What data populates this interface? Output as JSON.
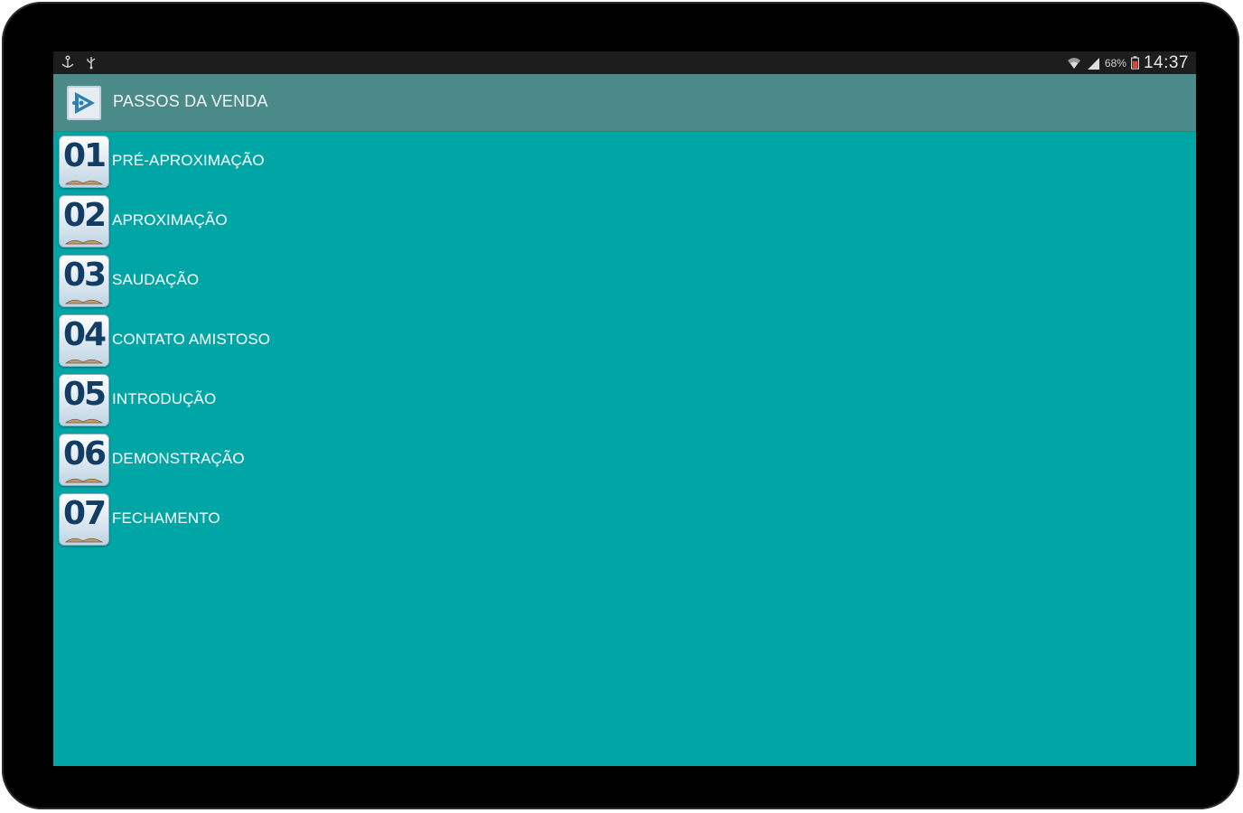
{
  "status_bar": {
    "battery_percent": "68%",
    "clock": "14:37"
  },
  "action_bar": {
    "title": "PASSOS DA VENDA",
    "icon": "play-arrow-icon"
  },
  "steps": [
    {
      "number": "01",
      "label": "PRÉ-APROXIMAÇÃO"
    },
    {
      "number": "02",
      "label": "APROXIMAÇÃO"
    },
    {
      "number": "03",
      "label": "SAUDAÇÃO"
    },
    {
      "number": "04",
      "label": "CONTATO AMISTOSO"
    },
    {
      "number": "05",
      "label": "INTRODUÇÃO"
    },
    {
      "number": "06",
      "label": "DEMONSTRAÇÃO"
    },
    {
      "number": "07",
      "label": "FECHAMENTO"
    }
  ],
  "colors": {
    "screen_background": "#00a6a6",
    "action_bar": "#4a8a88",
    "status_bar": "#1d1d1d",
    "badge_number": "#123e66"
  }
}
